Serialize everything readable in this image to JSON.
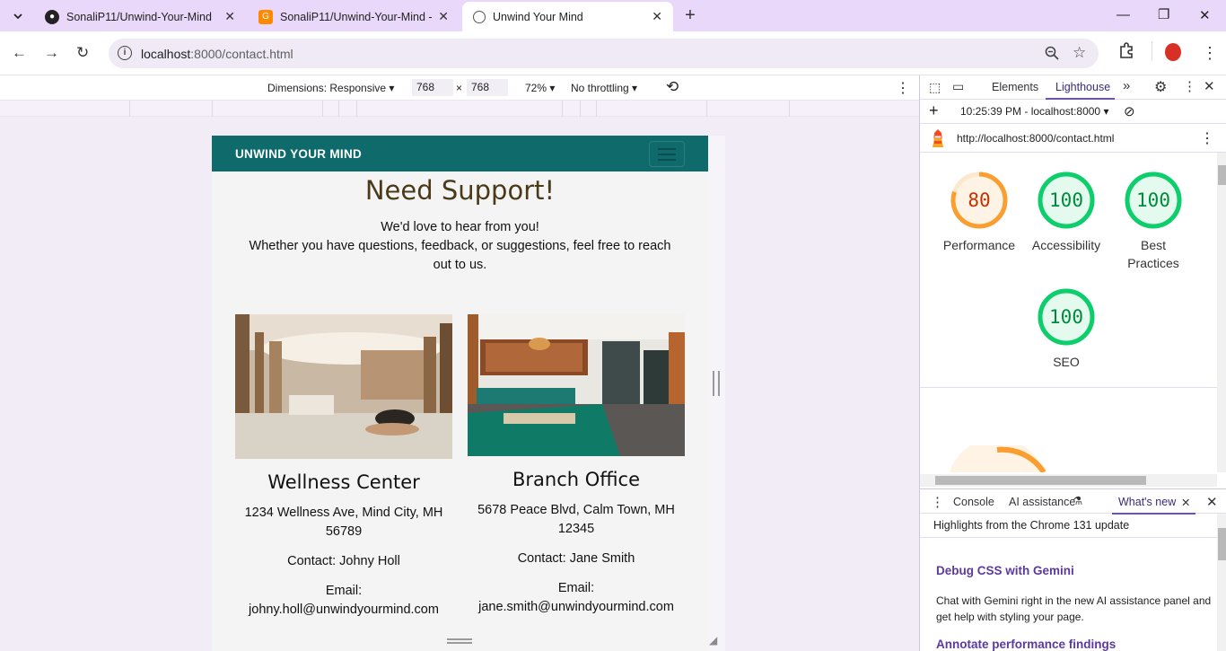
{
  "browser": {
    "tabs": [
      {
        "title": "SonaliP11/Unwind-Your-Mind",
        "icon": "github-icon"
      },
      {
        "title": "SonaliP11/Unwind-Your-Mind -",
        "icon": "gitpod-icon"
      },
      {
        "title": "Unwind Your Mind",
        "icon": "globe-icon"
      }
    ],
    "url_host": "localhost",
    "url_rest": ":8000/contact.html"
  },
  "device_toolbar": {
    "dimensions_label": "Dimensions: Responsive",
    "width": "768",
    "height": "768",
    "times": "×",
    "zoom": "72%",
    "throttling": "No throttling"
  },
  "site": {
    "brand": "UNWIND YOUR MIND",
    "heading": "Need Support!",
    "intro_line1": "We'd love to hear from you!",
    "intro_line2": "Whether you have questions, feedback, or suggestions, feel free to reach out to us.",
    "offices": [
      {
        "name": "Wellness Center",
        "address": "1234 Wellness Ave, Mind City, MH 56789",
        "contact": "Contact: Johny Holl",
        "email_label": "Email:",
        "email": "johny.holl@unwindyourmind.com"
      },
      {
        "name": "Branch Office",
        "address": "5678 Peace Blvd, Calm Town, MH 12345",
        "contact": "Contact: Jane Smith",
        "email_label": "Email:",
        "email": "jane.smith@unwindyourmind.com"
      }
    ]
  },
  "devtools": {
    "tabs": [
      "Elements",
      "Lighthouse"
    ],
    "report_time": "10:25:39 PM - localhost:8000",
    "report_url": "http://localhost:8000/contact.html",
    "scores": [
      {
        "value": 80,
        "label": "Performance",
        "color": "#fa9f2f"
      },
      {
        "value": 100,
        "label": "Accessibility",
        "color": "#0cce6b"
      },
      {
        "value": 100,
        "label": "Best Practices",
        "color": "#0cce6b"
      },
      {
        "value": 100,
        "label": "SEO",
        "color": "#0cce6b"
      }
    ],
    "drawer_tabs": [
      "Console",
      "AI assistance",
      "What's new"
    ],
    "whats_new_header": "Highlights from the Chrome 131 update",
    "items": [
      {
        "title": "Debug CSS with Gemini",
        "body": "Chat with Gemini right in the new AI assistance panel and get help with styling your page."
      },
      {
        "title": "Annotate performance findings",
        "body": ""
      }
    ]
  }
}
